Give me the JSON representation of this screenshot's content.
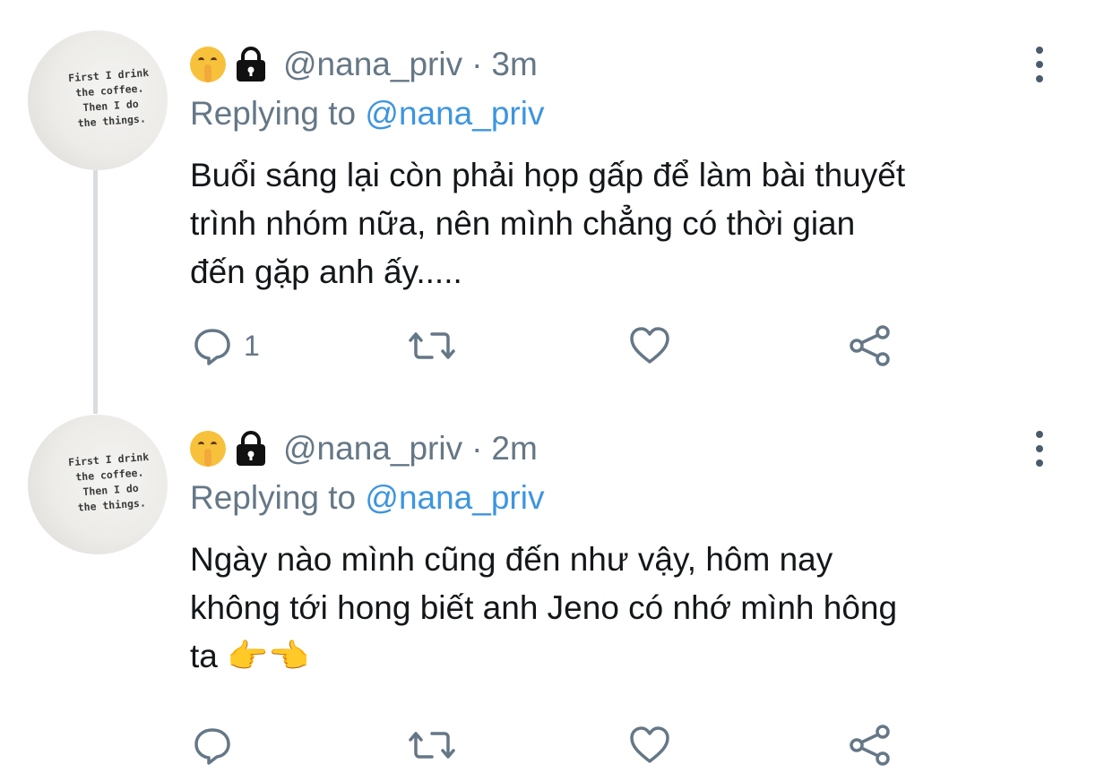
{
  "tweets": [
    {
      "handle": "@nana_priv",
      "separator": "·",
      "time": "3m",
      "replying_label": "Replying to",
      "replying_to": "@nana_priv",
      "text_lines": [
        "Buổi sáng lại còn phải họp gấp để làm bài thuyết",
        "trình nhóm nữa, nên mình chẳng có thời gian",
        "đến gặp anh ấy....."
      ],
      "reply_count": "1",
      "retweet_count": "",
      "like_count": ""
    },
    {
      "handle": "@nana_priv",
      "separator": "·",
      "time": "2m",
      "replying_label": "Replying to",
      "replying_to": "@nana_priv",
      "text_lines": [
        "Ngày nào mình cũng đến như vậy, hôm nay",
        "không tới hong biết anh Jeno có nhớ mình hông",
        "ta 👉👈"
      ],
      "reply_count": "",
      "retweet_count": "",
      "like_count": ""
    }
  ],
  "avatar": {
    "mug_text": [
      "First I drink",
      "the coffee.",
      "Then I do",
      "the things."
    ]
  },
  "icons": {
    "name_emoji_1": "shushing-face-emoji",
    "name_emoji_2": "lock-emoji",
    "reply": "reply-icon",
    "retweet": "retweet-icon",
    "like": "heart-icon",
    "share": "share-icon",
    "more": "more-vertical-icon"
  },
  "colors": {
    "link": "#3d95e0",
    "muted": "#657786",
    "text": "#14171a",
    "thread_line": "#d9dde2"
  }
}
